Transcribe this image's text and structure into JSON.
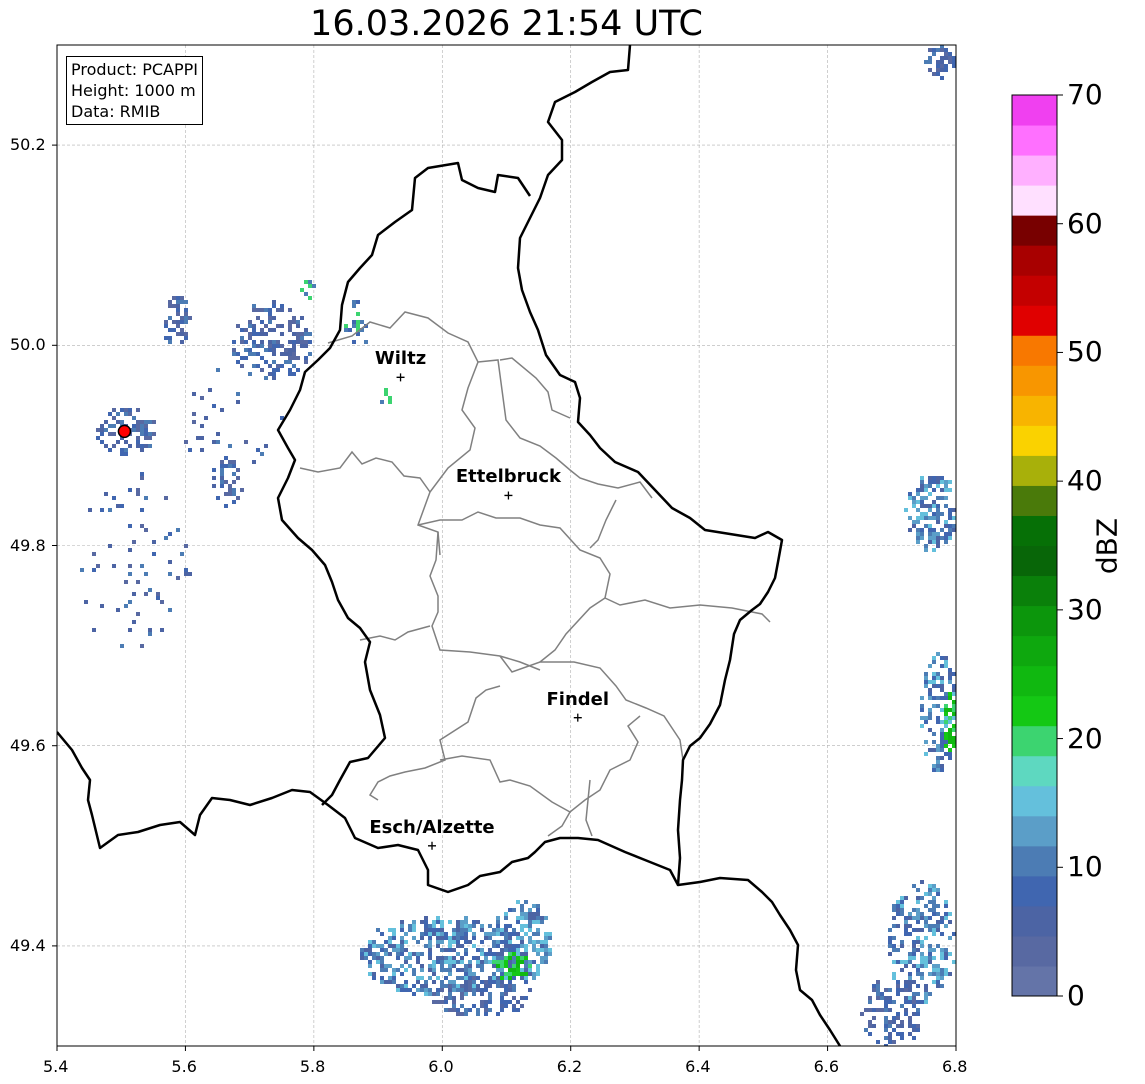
{
  "title": "16.03.2026 21:54 UTC",
  "info": {
    "product": "Product: PCAPPI",
    "height": "Height: 1000 m",
    "data": "Data: RMIB"
  },
  "map": {
    "lon_range": [
      5.4,
      6.8
    ],
    "lat_range": [
      49.3,
      50.3
    ],
    "x_ticks": [
      "5.4",
      "5.6",
      "5.8",
      "6.0",
      "6.2",
      "6.4",
      "6.6",
      "6.8"
    ],
    "y_ticks": [
      "50.2",
      "50.0",
      "49.8",
      "49.6",
      "49.4"
    ],
    "gridlines": true,
    "cities": [
      {
        "name": "Wiltz",
        "lon": 5.935,
        "lat": 49.968
      },
      {
        "name": "Ettelbruck",
        "lon": 6.103,
        "lat": 49.85
      },
      {
        "name": "Findel",
        "lon": 6.211,
        "lat": 49.628
      },
      {
        "name": "Esch/Alzette",
        "lon": 5.984,
        "lat": 49.5
      }
    ],
    "radar_site": {
      "lon": 5.505,
      "lat": 49.914,
      "color": "#ff0000"
    }
  },
  "colorbar": {
    "label": "dBZ",
    "ticks": [
      "0",
      "10",
      "20",
      "30",
      "40",
      "50",
      "60",
      "70"
    ],
    "colors": [
      "#6474a8",
      "#5869a2",
      "#4c64a4",
      "#4066b0",
      "#4c7cb4",
      "#5b9ec8",
      "#64c0dc",
      "#5ed8c0",
      "#3cd470",
      "#14c814",
      "#10b810",
      "#0ea80e",
      "#0c960c",
      "#0a800a",
      "#086608",
      "#067006",
      "#4a7a0a",
      "#a8b00a",
      "#fad200",
      "#f8b400",
      "#f89600",
      "#f87800",
      "#e00000",
      "#c40000",
      "#a80000",
      "#780000",
      "#ffe0ff",
      "#ffb0ff",
      "#ff70ff",
      "#f040f0"
    ]
  }
}
